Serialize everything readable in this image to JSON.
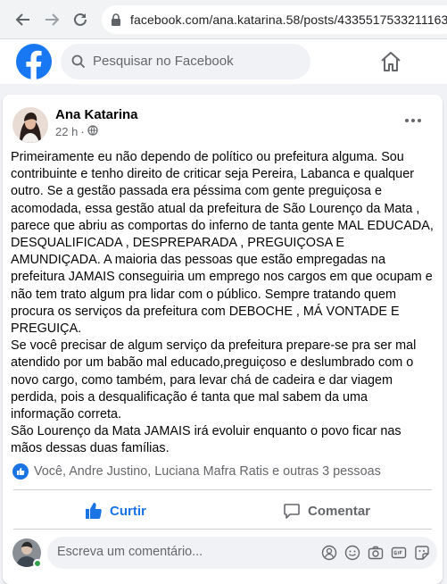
{
  "browser": {
    "url": "facebook.com/ana.katarina.58/posts/4335517533211163"
  },
  "header": {
    "search_placeholder": "Pesquisar no Facebook"
  },
  "post": {
    "author": "Ana Katarina",
    "time": "22 h",
    "paragraphs": [
      "Primeiramente eu não dependo de político ou prefeitura alguma. Sou contribuinte e tenho direito de criticar seja Pereira, Labanca e qualquer outro. Se a gestão passada era péssima com gente preguiçosa e acomodada, essa gestão atual da prefeitura de São Lourenço da Mata , parece que abriu as comportas do inferno de tanta gente MAL EDUCADA, DESQUALIFICADA , DESPREPARADA , PREGUIÇOSA E AMUNDIÇADA. A maioria das pessoas que estão empregadas na prefeitura JAMAIS conseguiria um emprego nos cargos em que ocupam e não tem trato algum pra lidar com o público. Sempre tratando quem procura os serviços da prefeitura com DEBOCHE , MÁ VONTADE E PREGUIÇA.",
      "Se você precisar de algum serviço da prefeitura prepare-se pra ser mal atendido por um babão mal educado,preguiçoso e deslumbrado com o novo cargo, como também, para levar chá de cadeira e dar viagem perdida, pois a desqualificação é tanta que mal sabem da uma informação correta.",
      "São Lourenço da Mata JAMAIS irá evoluir enquanto o povo ficar nas mãos dessas duas famílias."
    ],
    "reactions_text": "Você, Andre Justino, Luciana Mafra Ratis e outras 3 pessoas",
    "like_label": "Curtir",
    "comment_label": "Comentar",
    "comment_placeholder": "Escreva um comentário..."
  },
  "colors": {
    "brand": "#1877f2",
    "liked": "#1b74e4",
    "online": "#31a24c"
  }
}
